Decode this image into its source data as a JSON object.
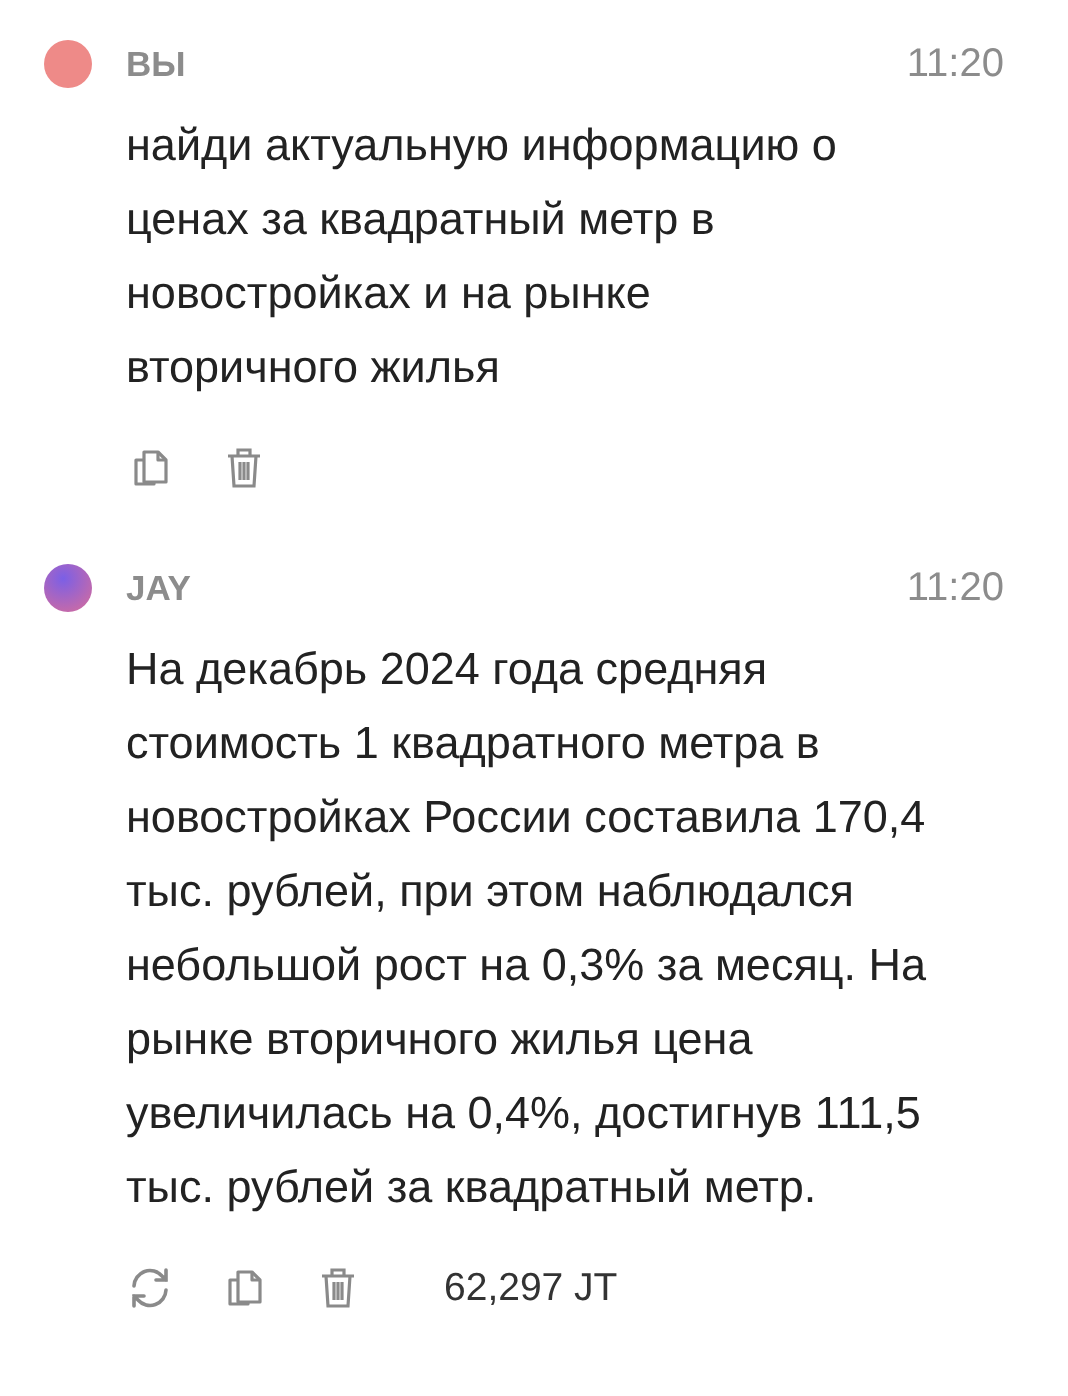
{
  "messages": [
    {
      "kind": "user",
      "author": "ВЫ",
      "time": "11:20",
      "text": "найди актуальную информацию о\nценах за квадратный метр в\nновостройках и на рынке\nвторичного жилья",
      "actions": [
        {
          "kind": "copy"
        },
        {
          "kind": "delete"
        }
      ]
    },
    {
      "kind": "assistant",
      "author": "JAY",
      "time": "11:20",
      "text": "На декабрь 2024 года средняя\nстоимость 1 квадратного метра в\nновостройках России составила 170,4\nтыс. рублей, при этом наблюдался\nнебольшой рост на 0,3% за месяц. На\nрынке вторичного жилья цена\nувеличилась на 0,4%, достигнув 111,5\nтыс. рублей за квадратный метр.",
      "actions": [
        {
          "kind": "regenerate"
        },
        {
          "kind": "copy"
        },
        {
          "kind": "delete"
        }
      ],
      "tokens": "62,297 JT"
    }
  ]
}
